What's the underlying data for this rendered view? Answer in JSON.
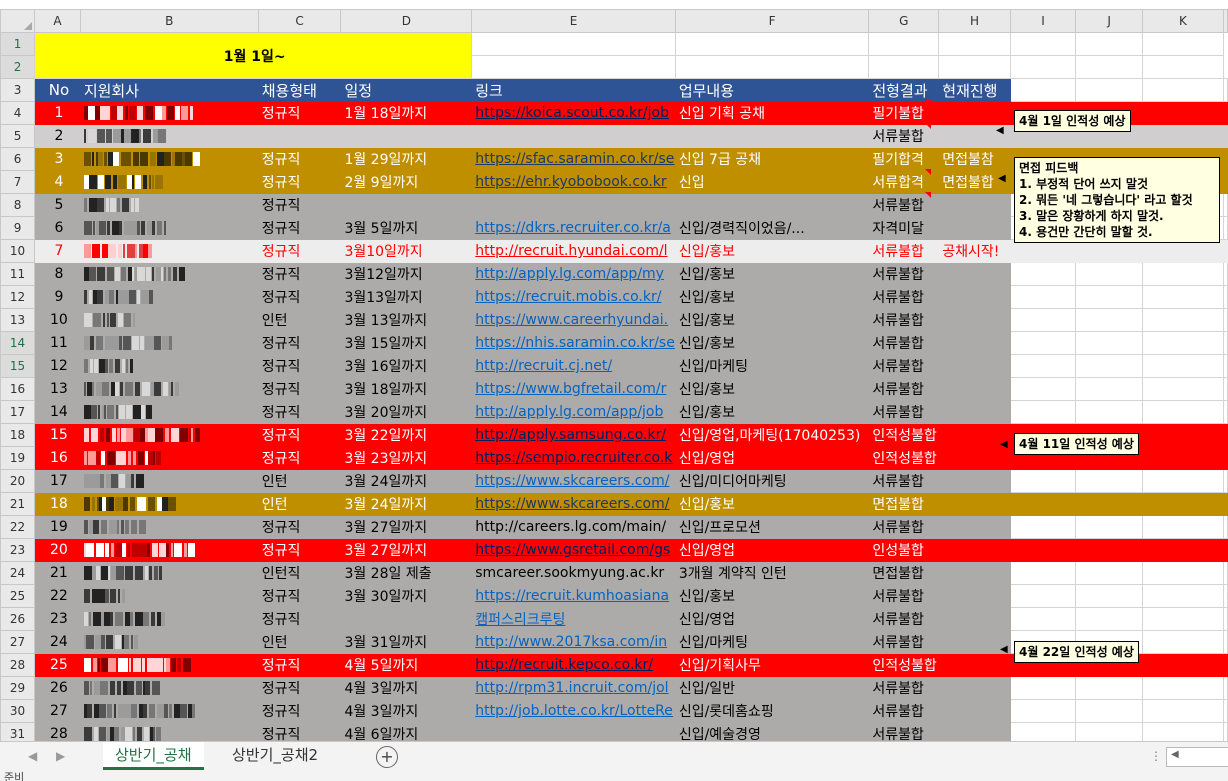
{
  "columns": [
    "A",
    "B",
    "C",
    "D",
    "E",
    "F",
    "G",
    "H",
    "I",
    "J",
    "K"
  ],
  "title": "1월 1일~",
  "header": {
    "no": "No",
    "company": "지원회사",
    "type": "채용형태",
    "date": "일정",
    "link": "링크",
    "task": "업무내용",
    "result": "전형결과",
    "status": "현재진행"
  },
  "rows": [
    {
      "n": "1",
      "no": "1",
      "type": "정규직",
      "date": "1월 18일까지",
      "link": "https://koica.scout.co.kr/job",
      "task": "신입 기획 공채",
      "result": "필기불합",
      "status": "",
      "style": "red",
      "comment": true
    },
    {
      "n": "2",
      "no": "2",
      "type": "",
      "date": "",
      "link": "",
      "task": "",
      "result": "서류불합",
      "status": "",
      "style": "lgray",
      "comment": true
    },
    {
      "n": "3",
      "no": "3",
      "type": "정규직",
      "date": "1월 29일까지",
      "link": "https://sfac.saramin.co.kr/se",
      "task": "신입 7급 공채",
      "result": "필기합격",
      "status": "면접불참",
      "style": "gold"
    },
    {
      "n": "4",
      "no": "4",
      "type": "정규직",
      "date": "2월 9일까지",
      "link": "https://ehr.kyobobook.co.kr",
      "task": "신입",
      "result": "서류합격",
      "status": "면접불합",
      "style": "gold",
      "comment": true
    },
    {
      "n": "5",
      "no": "5",
      "type": "정규직",
      "date": "",
      "link": "",
      "task": "",
      "result": "서류불합",
      "status": "",
      "style": "gray",
      "comment": true
    },
    {
      "n": "6",
      "no": "6",
      "type": "정규직",
      "date": "3월 5일까지",
      "link": "https://dkrs.recruiter.co.kr/a",
      "task": "신입/경력직이었음/...",
      "result": "자격미달",
      "status": "",
      "style": "gray"
    },
    {
      "n": "7",
      "no": "7",
      "type": "정규직",
      "date": "3월10일까지",
      "link": "http://recruit.hyundai.com/l",
      "task": "신입/홍보",
      "result": "서류불합",
      "status": "공채시작!",
      "style": "lite"
    },
    {
      "n": "8",
      "no": "8",
      "type": "정규직",
      "date": "3월12일까지",
      "link": "http://apply.lg.com/app/my",
      "task": "신입/홍보",
      "result": "서류불합",
      "status": "",
      "style": "gray"
    },
    {
      "n": "9",
      "no": "9",
      "type": "정규직",
      "date": "3월13일까지",
      "link": "https://recruit.mobis.co.kr/",
      "task": "신입/홍보",
      "result": "서류불합",
      "status": "",
      "style": "gray"
    },
    {
      "n": "10",
      "no": "10",
      "type": "인턴",
      "date": "3월 13일까지",
      "link": "https://www.careerhyundai.",
      "task": "신입/홍보",
      "result": "서류불합",
      "status": "",
      "style": "gray"
    },
    {
      "n": "11",
      "no": "11",
      "type": "정규직",
      "date": "3월 15일까지",
      "link": "https://nhis.saramin.co.kr/se",
      "task": "신입/홍보",
      "result": "서류불합",
      "status": "",
      "style": "gray"
    },
    {
      "n": "12",
      "no": "12",
      "type": "정규직",
      "date": "3월 16일까지",
      "link": "http://recruit.cj.net/",
      "task": "신입/마케팅",
      "result": "서류불합",
      "status": "",
      "style": "gray"
    },
    {
      "n": "13",
      "no": "13",
      "type": "정규직",
      "date": "3월 18일까지",
      "link": "https://www.bgfretail.com/r",
      "task": "신입/홍보",
      "result": "서류불합",
      "status": "",
      "style": "gray"
    },
    {
      "n": "14",
      "no": "14",
      "type": "정규직",
      "date": "3월 20일까지",
      "link": "http://apply.lg.com/app/job",
      "task": "신입/홍보",
      "result": "서류불합",
      "status": "",
      "style": "gray"
    },
    {
      "n": "15",
      "no": "15",
      "type": "정규직",
      "date": "3월 22일까지",
      "link": "http://apply.samsung.co.kr/",
      "task": "신입/영업,마케팅(17040253)",
      "result": "인적성불합",
      "status": "",
      "style": "red"
    },
    {
      "n": "16",
      "no": "16",
      "type": "정규직",
      "date": "3월 23일까지",
      "link": "https://sempio.recruiter.co.k",
      "task": "신입/영업",
      "result": "인적성불합",
      "status": "",
      "style": "red"
    },
    {
      "n": "17",
      "no": "17",
      "type": "인턴",
      "date": "3월 24일까지",
      "link": "https://www.skcareers.com/",
      "task": "신입/미디어마케팅",
      "result": "서류불합",
      "status": "",
      "style": "gray"
    },
    {
      "n": "18",
      "no": "18",
      "type": "인턴",
      "date": "3월 24일까지",
      "link": "https://www.skcareers.com/",
      "task": "신입/홍보",
      "result": "면접불합",
      "status": "",
      "style": "gold"
    },
    {
      "n": "19",
      "no": "19",
      "type": "정규직",
      "date": "3월 27일까지",
      "link": "http://careers.lg.com/main/",
      "task": "신입/프로모션",
      "result": "서류불합",
      "status": "",
      "style": "gray",
      "plain": true
    },
    {
      "n": "20",
      "no": "20",
      "type": "정규직",
      "date": "3월 27일까지",
      "link": "https://www.gsretail.com/gs",
      "task": "신입/영업",
      "result": "인성불합",
      "status": "",
      "style": "red"
    },
    {
      "n": "21",
      "no": "21",
      "type": "인턴직",
      "date": "3월 28일 제출",
      "link": "smcareer.sookmyung.ac.kr",
      "task": "3개월 계약직 인턴",
      "result": "면접불합",
      "status": "",
      "style": "gray",
      "plain": true
    },
    {
      "n": "22",
      "no": "22",
      "type": "정규직",
      "date": "3월 30일까지",
      "link": "https://recruit.kumhoasiana",
      "task": "신입/홍보",
      "result": "서류불합",
      "status": "",
      "style": "gray"
    },
    {
      "n": "23",
      "no": "23",
      "type": "정규직",
      "date": "",
      "link": "캠퍼스리크루팅",
      "task": "신입/영업",
      "result": "서류불합",
      "status": "",
      "style": "gray"
    },
    {
      "n": "24",
      "no": "24",
      "type": "인턴",
      "date": "3월 31일까지",
      "link": "http://www.2017ksa.com/in",
      "task": "신입/마케팅",
      "result": "서류불합",
      "status": "",
      "style": "gray"
    },
    {
      "n": "25",
      "no": "25",
      "type": "정규직",
      "date": "4월 5일까지",
      "link": "http://recruit.kepco.co.kr/",
      "task": "신입/기획사무",
      "result": "인적성불합",
      "status": "",
      "style": "red"
    },
    {
      "n": "26",
      "no": "26",
      "type": "정규직",
      "date": "4월 3일까지",
      "link": "http://rpm31.incruit.com/jol",
      "task": "신입/일반",
      "result": "서류불합",
      "status": "",
      "style": "gray"
    },
    {
      "n": "27",
      "no": "27",
      "type": "정규직",
      "date": "4월 3일까지",
      "link": "http://job.lotte.co.kr/LotteRe",
      "task": "신입/롯데홈쇼핑",
      "result": "서류불합",
      "status": "",
      "style": "gray"
    },
    {
      "n": "28",
      "no": "28",
      "type": "정규직",
      "date": "4월 6일까지",
      "link": "",
      "task": "신입/예술경영",
      "result": "서류불합",
      "status": "",
      "style": "gray"
    }
  ],
  "comments": {
    "c1": "4월 1일 인적성 예상",
    "c2": [
      "면접 피드백",
      "1. 부정적 단어 쓰지 말것",
      "2. 뭐든 '네 그렇습니다' 라고 할것",
      "3. 말은 장황하게 하지 말것.",
      "4. 용건만 간단히 말할 것."
    ],
    "c3": "4월 11일 인적성 예상",
    "c4": "4월 22일 인적성 예상"
  },
  "tabs": [
    "상반기_공채",
    "상반기_공채2"
  ],
  "status_text": "준비",
  "colors": {
    "red": "#ff0000",
    "gold": "#bf8f00",
    "gray": "#adaaaa",
    "header": "#2f5496",
    "title": "#ffff00"
  }
}
